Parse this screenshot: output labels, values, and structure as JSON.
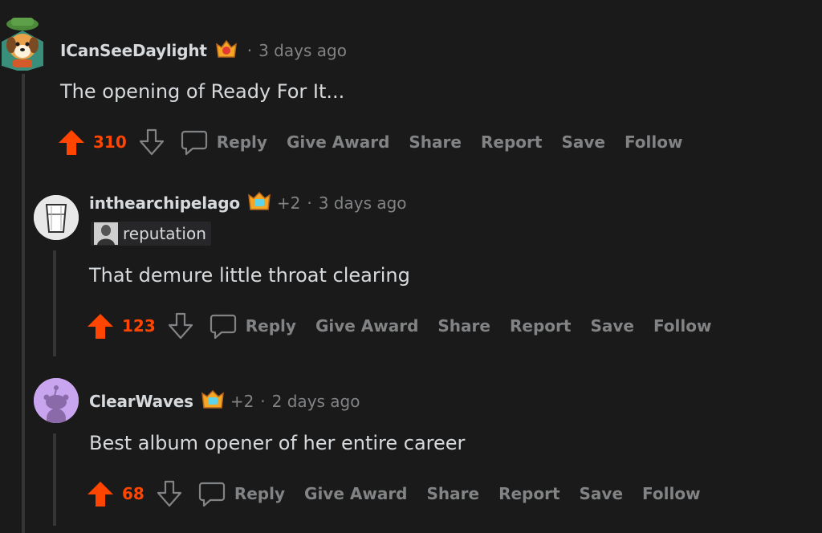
{
  "comments": [
    {
      "username": "ICanSeeDaylight",
      "award_count": "",
      "separator": "·",
      "time": "3 days ago",
      "text": "The opening of Ready For It...",
      "score": "310",
      "flair": ""
    },
    {
      "username": "inthearchipelago",
      "award_count": "+2",
      "separator": "·",
      "time": "3 days ago",
      "flair": "reputation",
      "text": "That demure little throat clearing",
      "score": "123"
    },
    {
      "username": "ClearWaves",
      "award_count": "+2",
      "separator": "·",
      "time": "2 days ago",
      "flair": "",
      "text": "Best album opener of her entire career",
      "score": "68"
    }
  ],
  "actions": {
    "reply": "Reply",
    "give_award": "Give Award",
    "share": "Share",
    "report": "Report",
    "save": "Save",
    "follow": "Follow"
  },
  "colors": {
    "background": "#1a1a1b",
    "upvote": "#ff4500",
    "muted": "#818384",
    "text": "#d7dadc",
    "thread_line": "#343536"
  },
  "icons": {
    "upvote": "arrow-up-icon",
    "downvote": "arrow-down-icon",
    "reply": "speech-bubble-icon",
    "award": "award-badge-icon"
  }
}
